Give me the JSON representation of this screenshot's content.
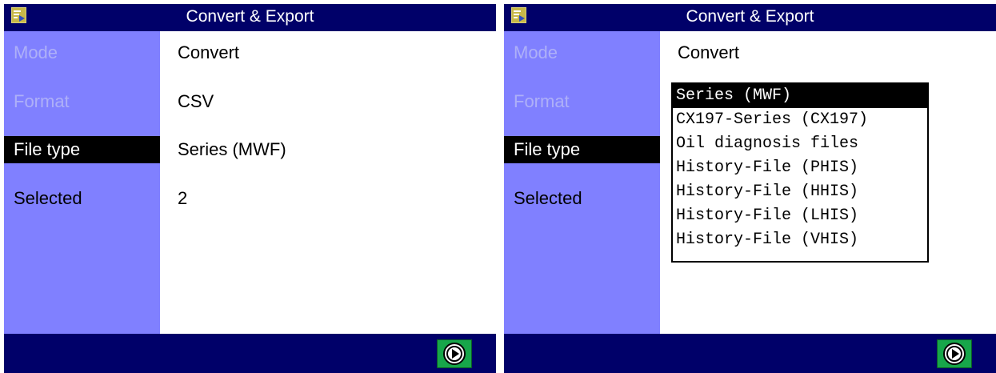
{
  "left": {
    "title": "Convert & Export",
    "fields": {
      "mode": {
        "label": "Mode",
        "value": "Convert"
      },
      "format": {
        "label": "Format",
        "value": "CSV"
      },
      "file_type": {
        "label": "File type",
        "value": "Series (MWF)"
      },
      "selected": {
        "label": "Selected",
        "value": "2"
      }
    }
  },
  "right": {
    "title": "Convert & Export",
    "fields": {
      "mode": {
        "label": "Mode",
        "value": "Convert"
      },
      "format": {
        "label": "Format"
      },
      "file_type": {
        "label": "File type"
      },
      "selected": {
        "label": "Selected"
      }
    },
    "dropdown": {
      "selected_index": 0,
      "options": [
        "Series (MWF)",
        "CX197-Series (CX197)",
        "Oil diagnosis files",
        "History-File (PHIS)",
        "History-File (HHIS)",
        "History-File (LHIS)",
        "History-File (VHIS)"
      ]
    }
  },
  "icons": {
    "app_icon": "export-app-icon",
    "start_button": "play-circle-icon"
  },
  "colors": {
    "title_bar": "#000069",
    "sidebar": "#8080ff",
    "disabled_label": "#aeb0f8",
    "selection": "#000000",
    "start_button": "#17a64a"
  }
}
